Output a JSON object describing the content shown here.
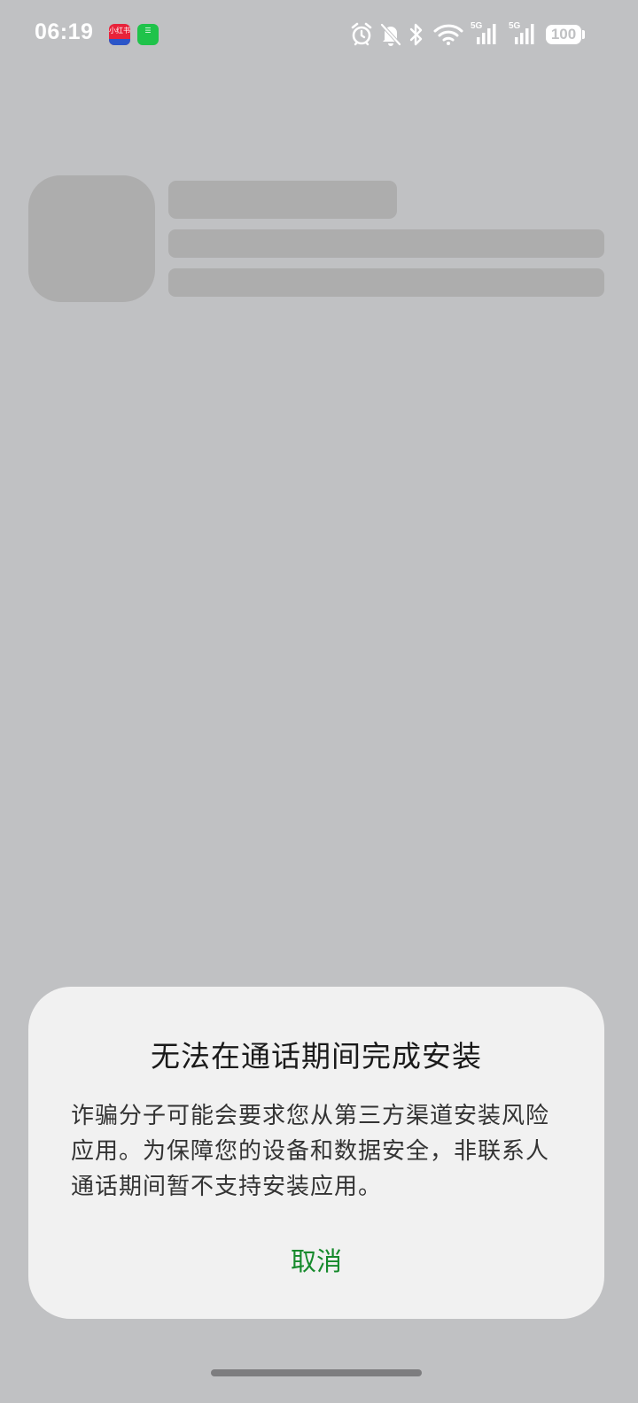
{
  "status_bar": {
    "time": "06:19",
    "notifications": [
      {
        "name": "xiaohongshu-app-icon",
        "color": "#e8233b",
        "label": "小红书"
      },
      {
        "name": "green-app-icon",
        "color": "#1fc34a",
        "label": "☰"
      }
    ],
    "icons": [
      "alarm-icon",
      "bell-muted-icon",
      "bluetooth-icon",
      "wifi-icon",
      "signal-5g-icon",
      "signal-5g-icon"
    ],
    "signal_label": "5G",
    "battery_level": "100"
  },
  "dialog": {
    "title": "无法在通话期间完成安装",
    "message": "诈骗分子可能会要求您从第三方渠道安装风险应用。为保障您的设备和数据安全，非联系人通话期间暂不支持安装应用。",
    "cancel_label": "取消",
    "accent_color": "#168a2c"
  },
  "colors": {
    "background": "#c0c1c3",
    "skeleton": "#adadad",
    "dialog_background": "#f1f1f1"
  }
}
